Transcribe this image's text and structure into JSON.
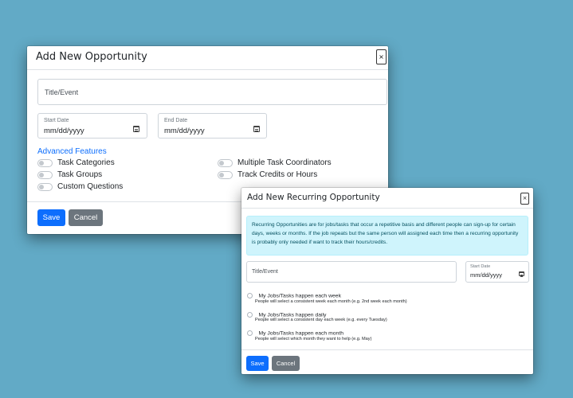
{
  "modal_opportunity": {
    "title": "Add New Opportunity",
    "close_label": "×",
    "title_event_placeholder": "Title/Event",
    "start_date": {
      "label": "Start Date",
      "value": "mm/dd/yyyy"
    },
    "end_date": {
      "label": "End Date",
      "value": "mm/dd/yyyy"
    },
    "advanced_features_label": "Advanced Features",
    "features_left": [
      "Task Categories",
      "Task Groups",
      "Custom Questions"
    ],
    "features_right": [
      "Multiple Task Coordinators",
      "Track Credits or Hours"
    ],
    "save_label": "Save",
    "cancel_label": "Cancel"
  },
  "modal_recurring": {
    "title": "Add New Recurring Opportunity",
    "close_label": "×",
    "info_text": "Recurring Opportunities are for jobs/tasks that occur a repetitive basis and different people can sign-up for certain days, weeks or months. If the job repeats but the same person will assigned each time then a recurring opportunity is probably only needed if want to track their hours/credits.",
    "title_event_placeholder": "Title/Event",
    "start_date": {
      "label": "Start Date",
      "value": "mm/dd/yyyy"
    },
    "options": [
      {
        "label": "My Jobs/Tasks happen each week",
        "help": "People will select a consistent week each month (e.g. 2nd week each month)"
      },
      {
        "label": "My Jobs/Tasks happen daily",
        "help": "People will select a consistent day each week (e.g. every Tuesday)"
      },
      {
        "label": "My Jobs/Tasks happen each month",
        "help": "People will select which month they want to help (e.g. May)"
      }
    ],
    "save_label": "Save",
    "cancel_label": "Cancel"
  },
  "colors": {
    "background": "#62aac6",
    "primary": "#0d6efd",
    "secondary": "#6c757d",
    "info_bg": "#cff4fc"
  }
}
